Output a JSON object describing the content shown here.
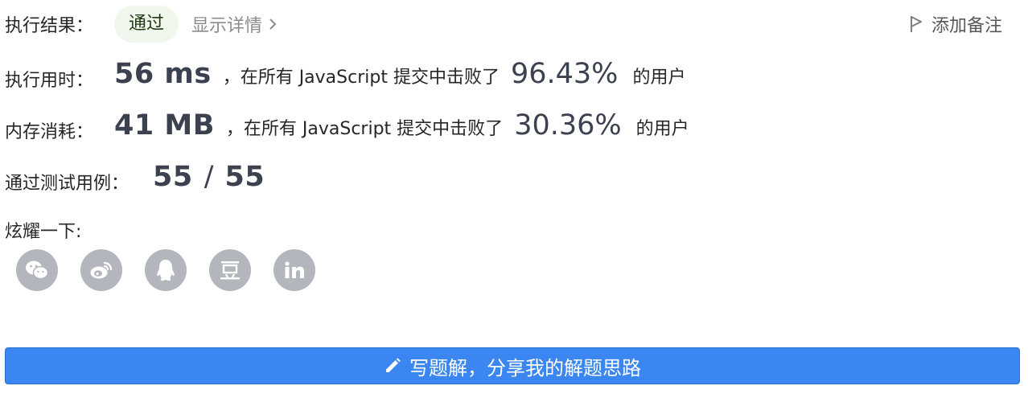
{
  "result": {
    "label": "执行结果：",
    "status": "通过",
    "detail_link": "显示详情",
    "add_note": "添加备注"
  },
  "runtime": {
    "label": "执行用时：",
    "value": "56 ms",
    "prefix": "，在所有 JavaScript 提交中击败了",
    "percent": "96.43%",
    "suffix": "的用户"
  },
  "memory": {
    "label": "内存消耗：",
    "value": "41 MB",
    "prefix": "，在所有 JavaScript 提交中击败了",
    "percent": "30.36%",
    "suffix": "的用户"
  },
  "tests": {
    "label": "通过测试用例：",
    "passed": "55",
    "separator": "/",
    "total": "55"
  },
  "share": {
    "label": "炫耀一下:",
    "items": [
      "wechat-icon",
      "weibo-icon",
      "qq-icon",
      "douban-icon",
      "linkedin-icon"
    ]
  },
  "write_solution": {
    "label": "写题解，分享我的解题思路"
  },
  "colors": {
    "accent": "#3b86f0",
    "pass_bg": "#f1f7ec",
    "icon_bg": "#b3b6bd"
  }
}
